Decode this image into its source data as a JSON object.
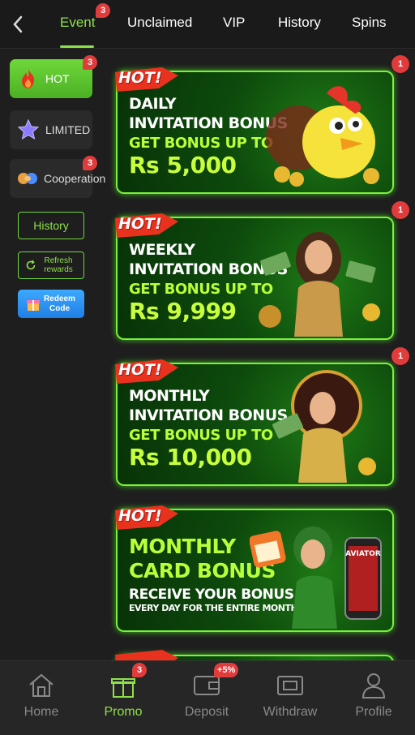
{
  "tabs": [
    {
      "label": "Event",
      "active": true,
      "badge": "3"
    },
    {
      "label": "Unclaimed"
    },
    {
      "label": "VIP"
    },
    {
      "label": "History"
    },
    {
      "label": "Spins"
    }
  ],
  "sidebar": {
    "hot": {
      "label": "HOT",
      "badge": "3",
      "icon": "fire-icon"
    },
    "limited": {
      "label": "LIMITED",
      "icon": "star-icon"
    },
    "cooperation": {
      "label": "Cooperation",
      "badge": "3",
      "icon": "handshake-icon"
    },
    "history_label": "History",
    "refresh_label": "Refresh rewards",
    "redeem_label": "Redeem Code"
  },
  "banners": [
    {
      "hot": "HOT!",
      "line1": "DAILY",
      "line2": "INVITATION BONUS",
      "line3": "GET BONUS UP TO",
      "amount": "Rs 5,000",
      "badge": "1"
    },
    {
      "hot": "HOT!",
      "line1": "WEEKLY",
      "line2": "INVITATION BONUS",
      "line3": "GET BONUS UP TO",
      "amount": "Rs 9,999",
      "badge": "1"
    },
    {
      "hot": "HOT!",
      "line1": "MONTHLY",
      "line2": "INVITATION BONUS",
      "line3": "GET BONUS UP TO",
      "amount": "Rs 10,000",
      "badge": "1"
    },
    {
      "hot": "HOT!",
      "line1": "MONTHLY",
      "line2": "CARD BONUS",
      "line3": "RECEIVE YOUR BONUS",
      "line4": "EVERY DAY FOR THE ENTIRE MONTH!",
      "brand": "AVIATOR"
    }
  ],
  "bottom_nav": [
    {
      "label": "Home",
      "icon": "home-icon"
    },
    {
      "label": "Promo",
      "icon": "gift-icon",
      "active": true,
      "badge": "3"
    },
    {
      "label": "Deposit",
      "icon": "wallet-icon",
      "badge": "+5%"
    },
    {
      "label": "Withdraw",
      "icon": "ticket-icon"
    },
    {
      "label": "Profile",
      "icon": "profile-icon"
    }
  ],
  "colors": {
    "accent": "#8ee04a",
    "badge": "#e03c3c",
    "background": "#1e1e1e",
    "banner_border": "#7cf03c"
  }
}
